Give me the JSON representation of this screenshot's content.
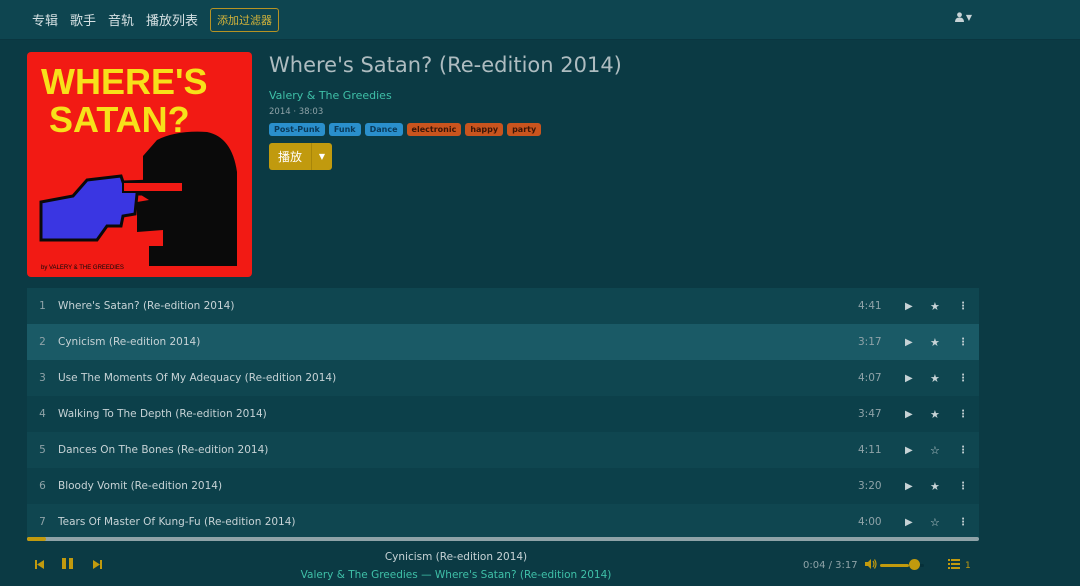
{
  "nav": {
    "links": [
      "专辑",
      "歌手",
      "音轨",
      "播放列表"
    ],
    "filter_button": "添加过滤器",
    "user_icon": "user-icon"
  },
  "album": {
    "cover_text_line1": "WHERE'S",
    "cover_text_line2": "SATAN?",
    "cover_credit": "by VALERY & THE GREEDIES",
    "title": "Where's Satan? (Re-edition 2014)",
    "artist": "Valery & The Greedies",
    "meta": "2014 · 38:03",
    "tags": [
      {
        "label": "Post-Punk",
        "color": "blue"
      },
      {
        "label": "Funk",
        "color": "blue"
      },
      {
        "label": "Dance",
        "color": "blue"
      },
      {
        "label": "electronic",
        "color": "orange"
      },
      {
        "label": "happy",
        "color": "orange"
      },
      {
        "label": "party",
        "color": "orange"
      }
    ],
    "play_label": "播放"
  },
  "tracks": [
    {
      "num": "1",
      "title": "Where's Satan? (Re-edition 2014)",
      "duration": "4:41",
      "starred": true,
      "active": false
    },
    {
      "num": "2",
      "title": "Cynicism (Re-edition 2014)",
      "duration": "3:17",
      "starred": true,
      "active": true
    },
    {
      "num": "3",
      "title": "Use The Moments Of My Adequacy (Re-edition 2014)",
      "duration": "4:07",
      "starred": true,
      "active": false
    },
    {
      "num": "4",
      "title": "Walking To The Depth (Re-edition 2014)",
      "duration": "3:47",
      "starred": true,
      "active": false
    },
    {
      "num": "5",
      "title": "Dances On The Bones (Re-edition 2014)",
      "duration": "4:11",
      "starred": false,
      "active": false
    },
    {
      "num": "6",
      "title": "Bloody Vomit (Re-edition 2014)",
      "duration": "3:20",
      "starred": true,
      "active": false
    },
    {
      "num": "7",
      "title": "Tears Of Master Of Kung-Fu (Re-edition 2014)",
      "duration": "4:00",
      "starred": false,
      "active": false
    }
  ],
  "player": {
    "progress_fraction": 0.02,
    "now_title": "Cynicism (Re-edition 2014)",
    "now_subtitle": "Valery & The Greedies — Where's Satan? (Re-edition 2014)",
    "time": "0:04 / 3:17",
    "volume_fraction": 0.66,
    "queue_count": "1"
  },
  "colors": {
    "background": "#0b3a44",
    "accent": "#c19a0e",
    "link": "#3fc0a8",
    "tag_blue": "#2a8fcc",
    "tag_orange": "#c9541e"
  }
}
